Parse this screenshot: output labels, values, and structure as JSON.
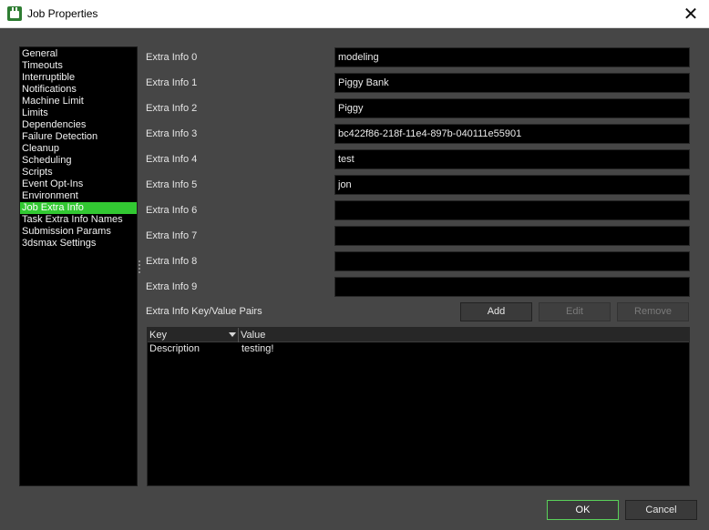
{
  "window": {
    "title": "Job Properties",
    "icon": "deadline-monitor-icon",
    "close_glyph": "✕"
  },
  "sidebar": {
    "items": [
      {
        "label": "General"
      },
      {
        "label": "Timeouts"
      },
      {
        "label": "Interruptible"
      },
      {
        "label": "Notifications"
      },
      {
        "label": "Machine Limit"
      },
      {
        "label": "Limits"
      },
      {
        "label": "Dependencies"
      },
      {
        "label": "Failure Detection"
      },
      {
        "label": "Cleanup"
      },
      {
        "label": "Scheduling"
      },
      {
        "label": "Scripts"
      },
      {
        "label": "Event Opt-Ins"
      },
      {
        "label": "Environment"
      },
      {
        "label": "Job Extra Info"
      },
      {
        "label": "Task Extra Info Names"
      },
      {
        "label": "Submission Params"
      },
      {
        "label": "3dsmax Settings"
      }
    ],
    "selected": "Job Extra Info",
    "selected_color": "#32c832"
  },
  "extra_info": [
    {
      "label": "Extra Info 0",
      "value": "modeling"
    },
    {
      "label": "Extra Info 1",
      "value": "Piggy Bank"
    },
    {
      "label": "Extra Info 2",
      "value": "Piggy"
    },
    {
      "label": "Extra Info 3",
      "value": "bc422f86-218f-11e4-897b-040111e55901"
    },
    {
      "label": "Extra Info 4",
      "value": "test"
    },
    {
      "label": "Extra Info 5",
      "value": "jon"
    },
    {
      "label": "Extra Info 6",
      "value": ""
    },
    {
      "label": "Extra Info 7",
      "value": ""
    },
    {
      "label": "Extra Info 8",
      "value": ""
    },
    {
      "label": "Extra Info 9",
      "value": ""
    }
  ],
  "kv": {
    "label": "Extra Info Key/Value Pairs",
    "add_label": "Add",
    "edit_label": "Edit",
    "remove_label": "Remove",
    "columns": {
      "key": "Key",
      "value": "Value"
    },
    "rows": [
      {
        "key": "Description",
        "value": "testing!"
      }
    ]
  },
  "footer": {
    "ok_label": "OK",
    "cancel_label": "Cancel",
    "ok_border_color": "#5ad05a"
  }
}
